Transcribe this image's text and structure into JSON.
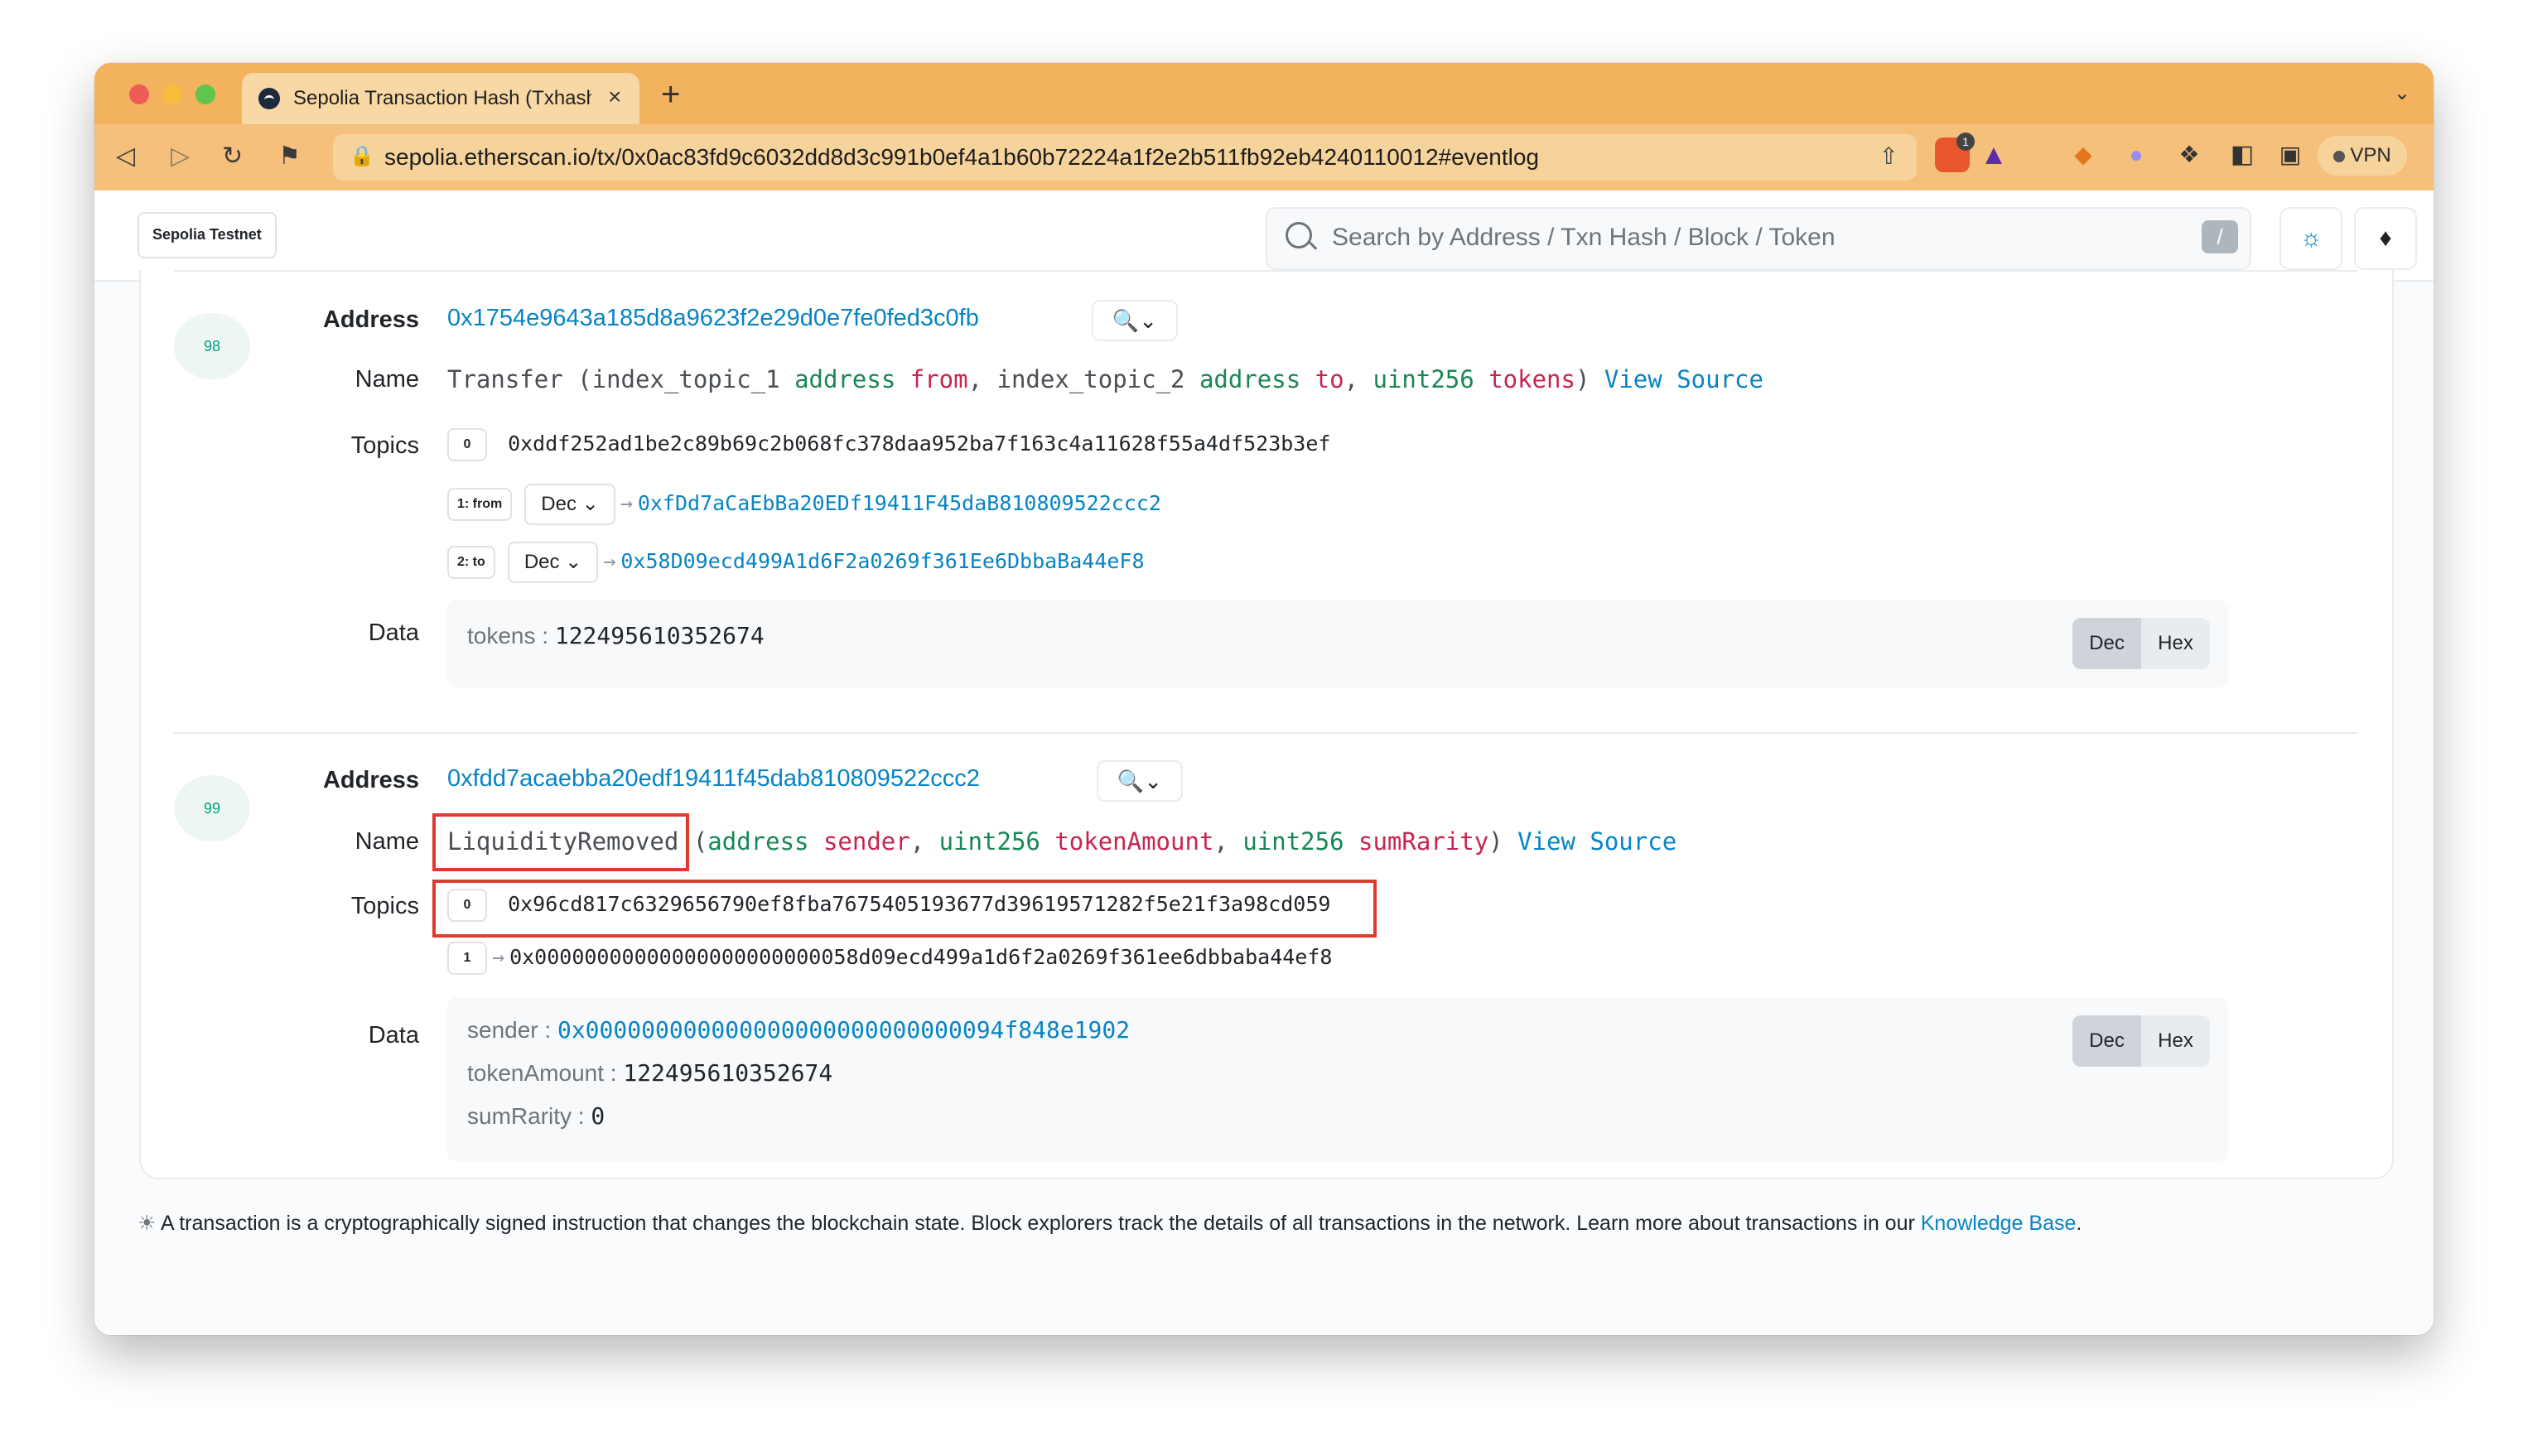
{
  "browser": {
    "tab_title": "Sepolia Transaction Hash (Txhash) Details",
    "url": "sepolia.etherscan.io/tx/0x0ac83fd9c6032dd8d3c991b0ef4a1b60b72224a1f2e2b511fb92eb4240110012#eventlog",
    "vpn_label": "VPN",
    "new_tab_symbol": "+",
    "close_tab_symbol": "×",
    "brave_badge_count": "1"
  },
  "header": {
    "network_badge": "Sepolia Testnet",
    "search_placeholder": "Search by Address / Txn Hash / Block / Token",
    "search_shortcut": "/"
  },
  "labels": {
    "address": "Address",
    "name": "Name",
    "topics": "Topics",
    "data": "Data",
    "view_source": "View Source",
    "dec": "Dec",
    "hex": "Hex",
    "arrow": "→"
  },
  "logs": [
    {
      "index": "98",
      "address": "0x1754e9643a185d8a9623f2e29d0e7fe0fed3c0fb",
      "name": {
        "event": "Transfer",
        "params": [
          {
            "prefix": "index_topic_1",
            "type": "address",
            "name": "from"
          },
          {
            "prefix": "index_topic_2",
            "type": "address",
            "name": "to"
          },
          {
            "prefix": "",
            "type": "uint256",
            "name": "tokens"
          }
        ]
      },
      "topics": [
        {
          "label": "0",
          "value": "0xddf252ad1be2c89b69c2b068fc378daa952ba7f163c4a11628f55a4df523b3ef"
        },
        {
          "label": "1: from",
          "format": "Dec",
          "value": "0xfDd7aCaEbBa20EDf19411F45daB810809522ccc2"
        },
        {
          "label": "2: to",
          "format": "Dec",
          "value": "0x58D09ecd499A1d6F2a0269f361Ee6DbbaBa44eF8"
        }
      ],
      "data": [
        {
          "key": "tokens",
          "value": "122495610352674"
        }
      ]
    },
    {
      "index": "99",
      "address": "0xfdd7acaebba20edf19411f45dab810809522ccc2",
      "name": {
        "event": "LiquidityRemoved",
        "params": [
          {
            "type": "address",
            "name": "sender"
          },
          {
            "type": "uint256",
            "name": "tokenAmount"
          },
          {
            "type": "uint256",
            "name": "sumRarity"
          }
        ]
      },
      "topics": [
        {
          "label": "0",
          "value": "0x96cd817c6329656790ef8fba7675405193677d39619571282f5e21f3a98cd059"
        },
        {
          "label": "1",
          "value": "0x00000000000000000000000058d09ecd499a1d6f2a0269f361ee6dbbaba44ef8"
        }
      ],
      "data": [
        {
          "key": "sender",
          "value": "0x000000000000000000000000000094f848e1902"
        },
        {
          "key": "tokenAmount",
          "value": "122495610352674"
        },
        {
          "key": "sumRarity",
          "value": "0"
        }
      ]
    }
  ],
  "footer": {
    "text": "A transaction is a cryptographically signed instruction that changes the blockchain state. Block explorers track the details of all transactions in the network. Learn more about transactions in our ",
    "link": "Knowledge Base",
    "end": "."
  }
}
